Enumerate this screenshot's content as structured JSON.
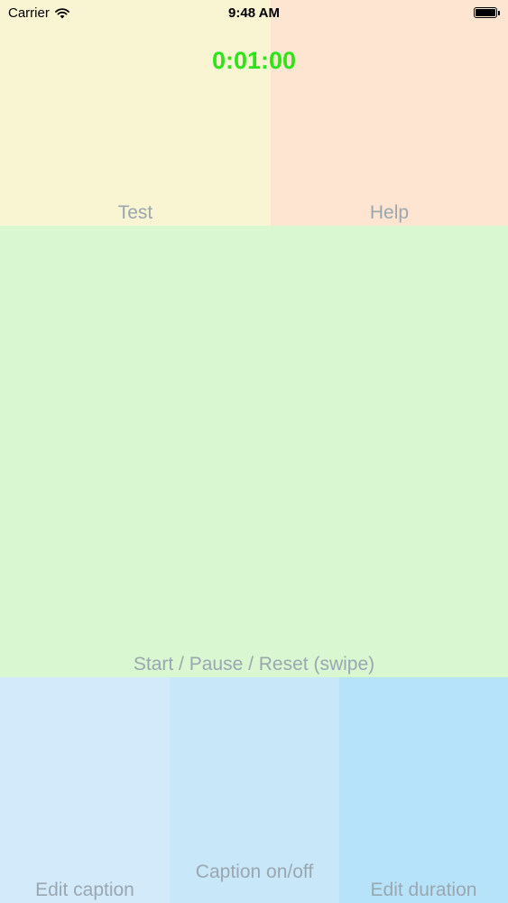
{
  "status_bar": {
    "carrier": "Carrier",
    "time": "9:48 AM",
    "wifi_icon": "wifi-icon",
    "battery_icon": "battery-icon"
  },
  "timer": {
    "value": "0:01:00",
    "color": "#2ce417"
  },
  "zones": {
    "test": {
      "label": "Test",
      "color": "#f9f4d2"
    },
    "help": {
      "label": "Help",
      "color": "#fde5d2"
    },
    "main": {
      "label": "Start / Pause / Reset (swipe)",
      "color": "#d9f7d1"
    },
    "edit_caption": {
      "label": "Edit caption",
      "color": "#d3eafa"
    },
    "caption_toggle": {
      "label": "Caption on/off",
      "color": "#c8e7f8"
    },
    "edit_duration": {
      "label": "Edit duration",
      "color": "#b6e3f9"
    }
  }
}
